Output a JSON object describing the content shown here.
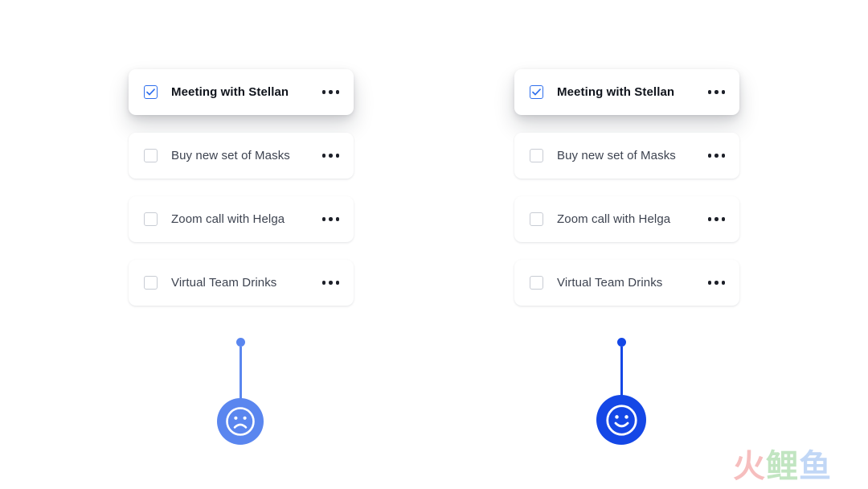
{
  "background_color": "#ffffff",
  "accent_color": "#2f6fed",
  "columns": [
    {
      "name": "left-column",
      "tasks": [
        {
          "label": "Meeting with Stellan",
          "checked": true,
          "active": true,
          "menu_icon": "more-horizontal-icon"
        },
        {
          "label": "Buy new set of Masks",
          "checked": false,
          "active": false,
          "menu_icon": "more-horizontal-icon"
        },
        {
          "label": "Zoom call with Helga",
          "checked": false,
          "active": false,
          "menu_icon": "more-horizontal-icon"
        },
        {
          "label": "Virtual Team Drinks",
          "checked": false,
          "active": false,
          "menu_icon": "more-horizontal-icon"
        }
      ],
      "mood": {
        "icon": "sad-face-icon",
        "expression": "sad",
        "color": "#5a86ef",
        "stem_color": "#5a86ef"
      }
    },
    {
      "name": "right-column",
      "tasks": [
        {
          "label": "Meeting with Stellan",
          "checked": true,
          "active": true,
          "menu_icon": "more-horizontal-icon"
        },
        {
          "label": "Buy new set of Masks",
          "checked": false,
          "active": false,
          "menu_icon": "more-horizontal-icon"
        },
        {
          "label": "Zoom call with Helga",
          "checked": false,
          "active": false,
          "menu_icon": "more-horizontal-icon"
        },
        {
          "label": "Virtual Team Drinks",
          "checked": false,
          "active": false,
          "menu_icon": "more-horizontal-icon"
        }
      ],
      "mood": {
        "icon": "happy-face-icon",
        "expression": "happy",
        "color": "#1447e6",
        "stem_color": "#1447e6"
      }
    }
  ],
  "watermark": {
    "characters": [
      {
        "text": "火",
        "color": "#f08a8a"
      },
      {
        "text": "鲤",
        "color": "#8fd08f"
      },
      {
        "text": "鱼",
        "color": "#8fb7ef"
      }
    ]
  }
}
